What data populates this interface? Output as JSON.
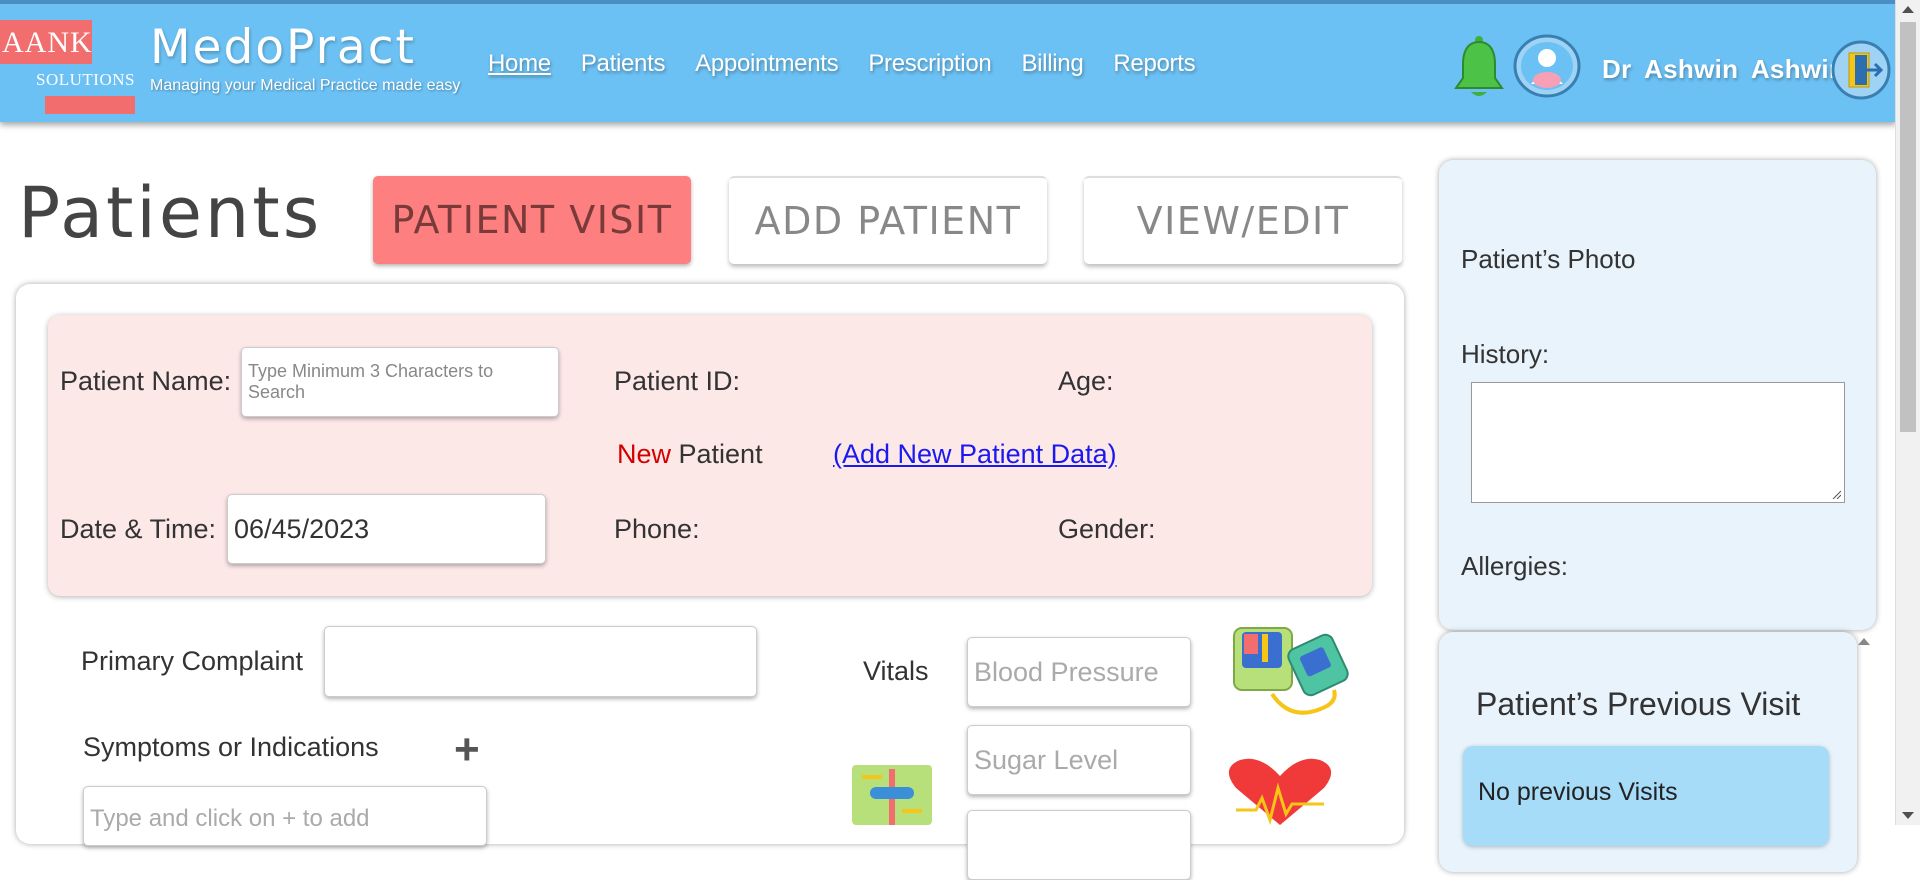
{
  "logo": {
    "name": "AANK",
    "sub": "SOLUTIONS"
  },
  "brand": {
    "name": "MedoPract",
    "tagline": "Managing your Medical Practice made easy"
  },
  "nav": [
    {
      "label": "Home",
      "active": true
    },
    {
      "label": "Patients"
    },
    {
      "label": "Appointments"
    },
    {
      "label": "Prescription"
    },
    {
      "label": "Billing"
    },
    {
      "label": "Reports"
    }
  ],
  "user": {
    "name": "Dr  Ashwin  Ashwin"
  },
  "page": {
    "title": "Patients"
  },
  "tabs": {
    "visit": "PATIENT VISIT",
    "add": "ADD PATIENT",
    "view": "VIEW/EDIT"
  },
  "patient_info": {
    "name_label": "Patient Name:",
    "name_placeholder": "Type Minimum 3 Characters to Search",
    "id_label": "Patient ID:",
    "age_label": "Age:",
    "new_word": "New",
    "patient_word": " Patient",
    "add_link": "(Add New Patient Data)",
    "date_label": "Date & Time:",
    "date_value": "06/45/2023",
    "phone_label": "Phone:",
    "gender_label": "Gender:"
  },
  "complaint": {
    "label": "Primary Complaint"
  },
  "symptoms": {
    "label": "Symptoms or Indications",
    "add": "+",
    "placeholder": "Type and click on + to add"
  },
  "vitals": {
    "label": "Vitals",
    "bp_placeholder": "Blood Pressure",
    "sugar_placeholder": "Sugar Level"
  },
  "side_panel": {
    "photo_label": "Patient’s Photo",
    "history_label": "History:",
    "allergies_label": "Allergies:"
  },
  "previous_visit": {
    "title": "Patient’s Previous Visit",
    "empty_text": "No previous Visits"
  },
  "colors": {
    "header": "#6cc1f4",
    "accent_red": "#fd7f7f",
    "info_bg": "#fde8e8",
    "panel_bg": "#e8f3fb",
    "new_red": "#d40000",
    "link_blue": "#1a1aee"
  }
}
